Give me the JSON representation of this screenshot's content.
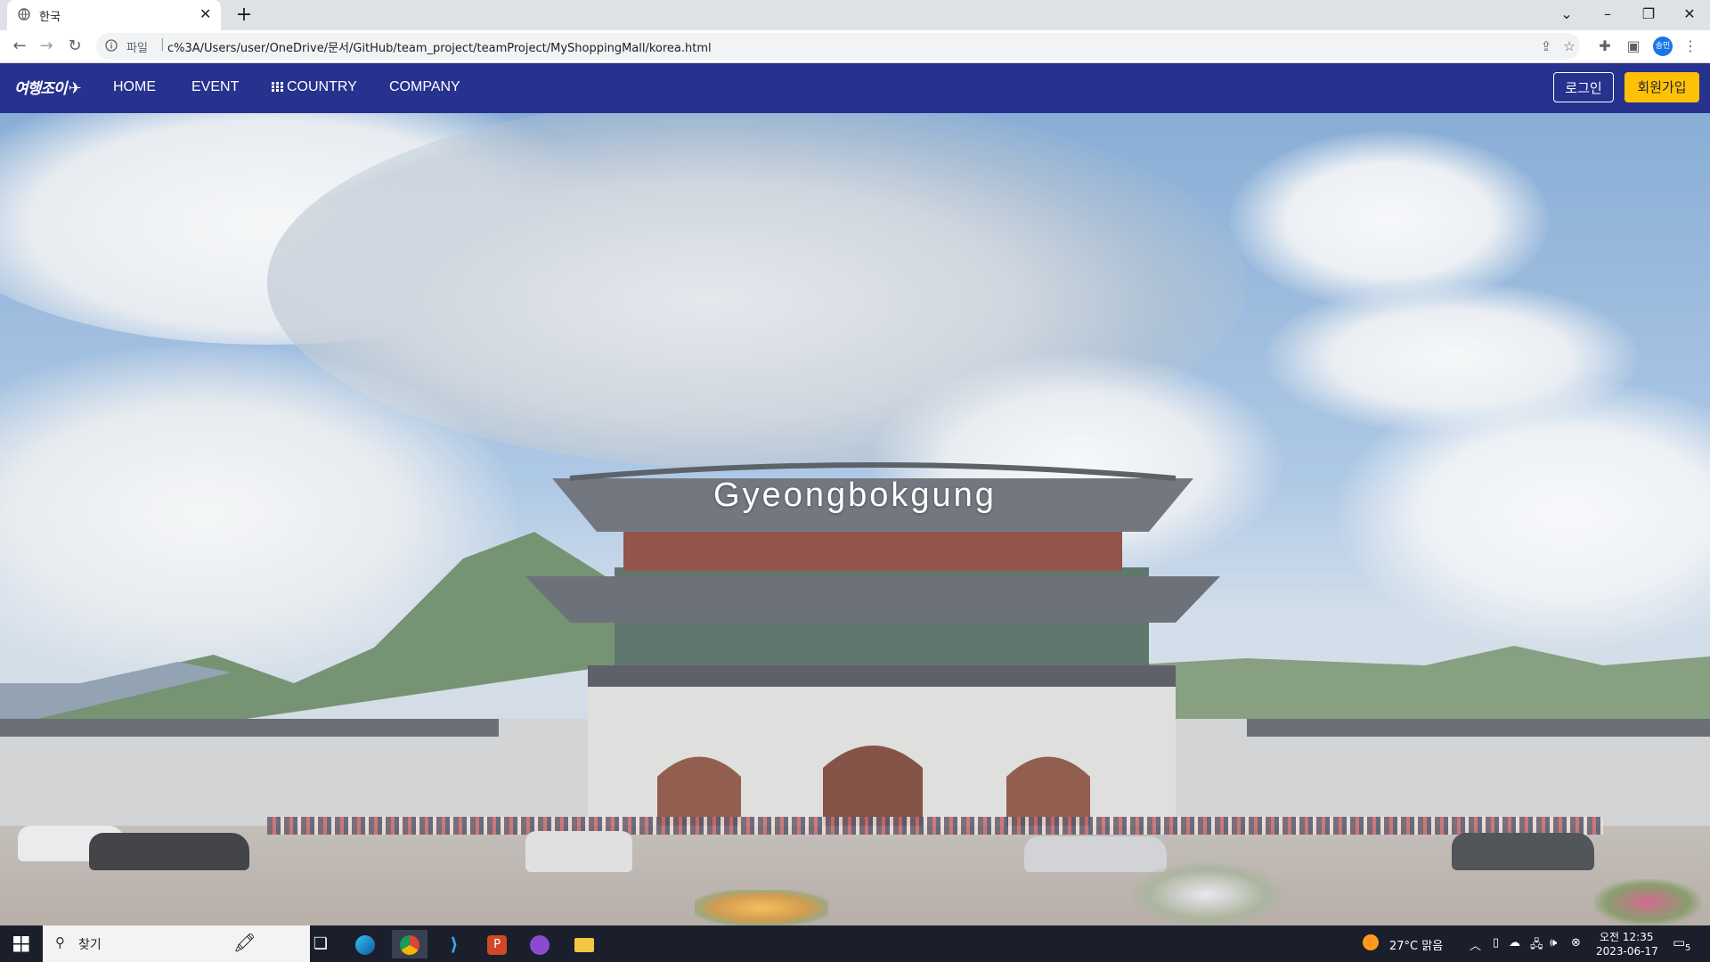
{
  "browser": {
    "tab_title": "한국",
    "scheme_label": "파일",
    "url": "c%3A/Users/user/OneDrive/문서/GitHub/team_project/teamProject/MyShoppingMall/korea.html",
    "profile_initials": "송민"
  },
  "site": {
    "logo_text": "여행조이",
    "nav": [
      {
        "label": "HOME"
      },
      {
        "label": "EVENT"
      },
      {
        "label": "COUNTRY"
      },
      {
        "label": "COMPANY"
      }
    ],
    "login_label": "로그인",
    "signup_label": "회원가입",
    "nav_color": "#27318e",
    "signup_color": "#ffc107"
  },
  "hero": {
    "title": "Gyeongbokgung"
  },
  "taskbar": {
    "search_label": "찾기",
    "weather": "27°C  맑음",
    "time": "오전 12:35",
    "date": "2023-06-17",
    "notification_count": "5"
  }
}
